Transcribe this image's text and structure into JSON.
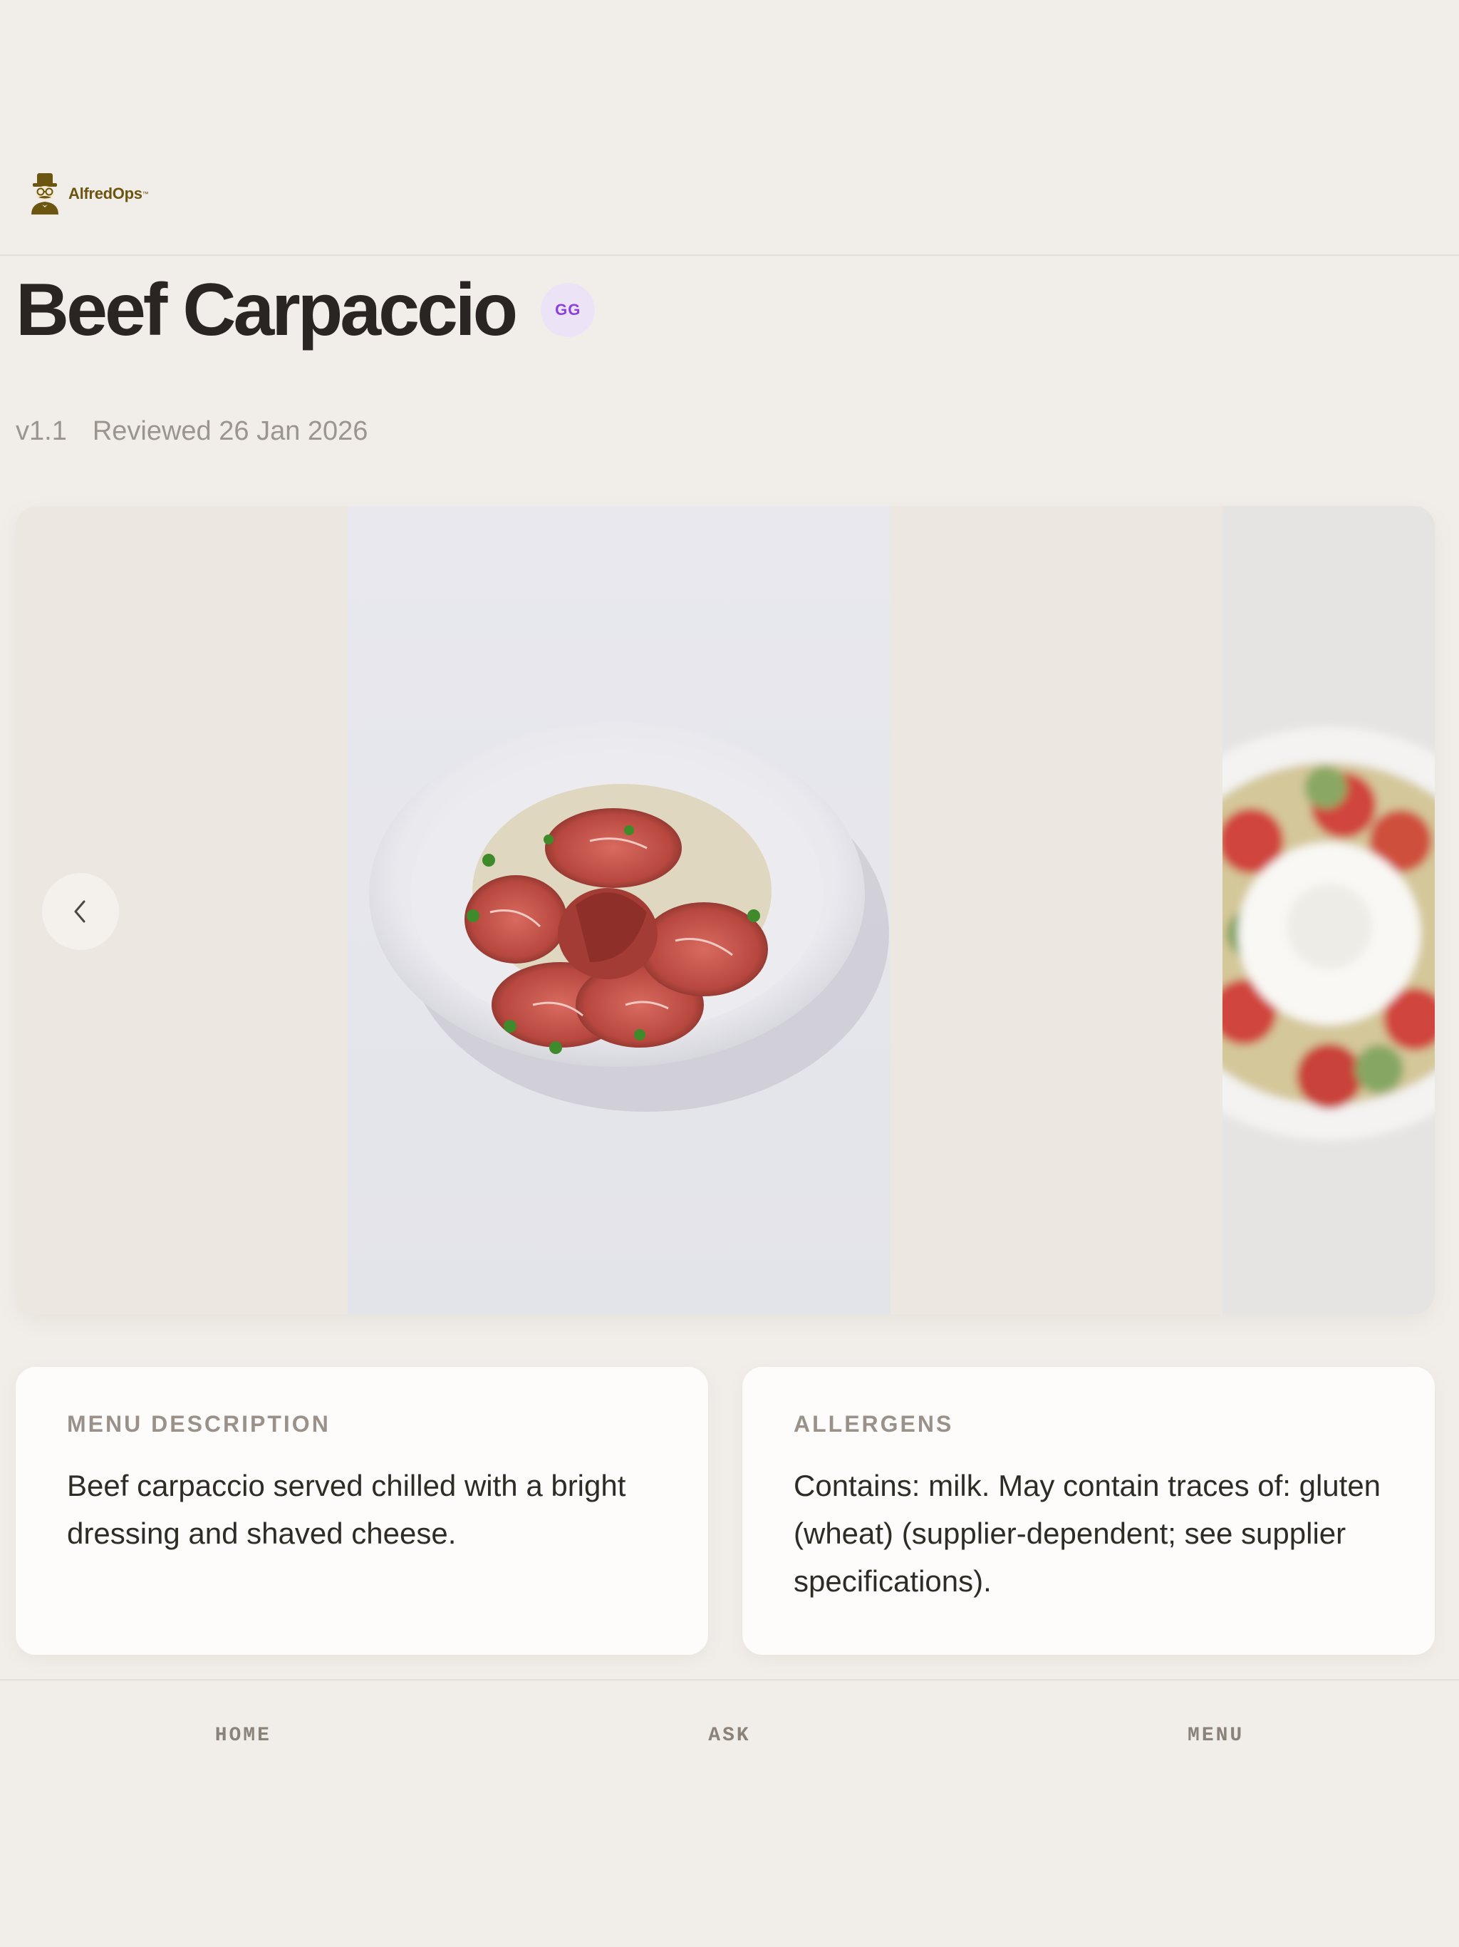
{
  "brand": {
    "name": "AlfredOps",
    "trademark": "™",
    "logo_color": "#6b5510"
  },
  "dish": {
    "title": "Beef Carpaccio",
    "author_initials": "GG",
    "version": "v1.1",
    "reviewed": "Reviewed 26 Jan 2026"
  },
  "carousel": {
    "prev_icon": "chevron-left-icon",
    "slides": [
      "beef-carpaccio-photo",
      "burrata-photo"
    ]
  },
  "description": {
    "label": "MENU DESCRIPTION",
    "text": "Beef carpaccio served chilled with a bright dressing and shaved cheese."
  },
  "allergens": {
    "label": "ALLERGENS",
    "text": "Contains: milk. May contain traces of: gluten (wheat) (supplier-dependent; see supplier specifications)."
  },
  "nav": {
    "items": [
      {
        "label": "HOME"
      },
      {
        "label": "ASK"
      },
      {
        "label": "MENU"
      }
    ]
  },
  "colors": {
    "background": "#f1eeea",
    "avatar_bg": "#ece4f6",
    "avatar_text": "#8c3fe0"
  }
}
